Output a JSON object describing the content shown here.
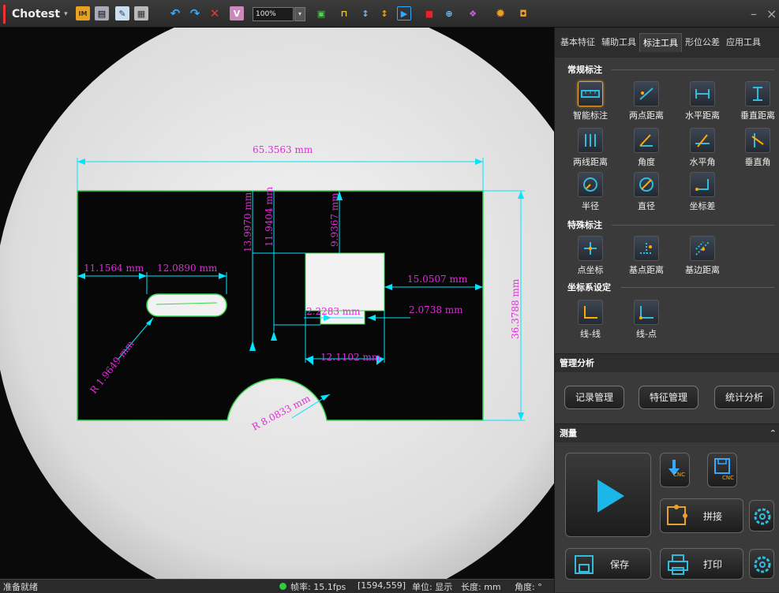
{
  "toolbar": {
    "app_name": "Chotest",
    "zoom_value": "100%",
    "window_controls": [
      "–",
      "×"
    ]
  },
  "canvas": {
    "measurements": {
      "width_top": "65.3563 mm",
      "left_a": "11.1564 mm",
      "left_b": "12.0890 mm",
      "vert_a": "13.9970 mm",
      "vert_b": "11.9404 mm",
      "vert_c": "9.9367 mm",
      "right_a": "15.0507 mm",
      "height_right": "36.3788 mm",
      "small_a": "2.2283 mm",
      "small_b": "2.0738 mm",
      "bottom_w": "12.1102 mm",
      "radius_slot": "R 1.9649 mm",
      "radius_arc": "R 8.0833 mm"
    },
    "colors": {
      "dimension": "#00e5ff",
      "label": "#e22bd8",
      "edge": "#3cd64e"
    }
  },
  "statusbar": {
    "ready": "准备就绪",
    "fps": "帧率: 15.1fps",
    "coords": "[1594,559]",
    "unit": "单位: 显示",
    "length": "长度: mm",
    "angle": "角度: °"
  },
  "panel": {
    "tabs": [
      "基本特征",
      "辅助工具",
      "标注工具",
      "形位公差",
      "应用工具"
    ],
    "active_tab": "标注工具",
    "sections": {
      "regular": "常规标注",
      "special": "特殊标注",
      "coordsys": "坐标系设定"
    },
    "regular_tools": [
      "智能标注",
      "两点距离",
      "水平距离",
      "垂直距离",
      "两线距离",
      "角度",
      "水平角",
      "垂直角",
      "半径",
      "直径",
      "坐标差"
    ],
    "special_tools": [
      "点坐标",
      "基点距离",
      "基边距离"
    ],
    "coordsys_tools": [
      "线-线",
      "线-点"
    ],
    "manage": {
      "header": "管理分析",
      "buttons": [
        "记录管理",
        "特征管理",
        "统计分析"
      ]
    },
    "measure": {
      "header": "测量",
      "cnc_label": "CNC",
      "stitch": "拼接",
      "save": "保存",
      "print": "打印"
    }
  }
}
